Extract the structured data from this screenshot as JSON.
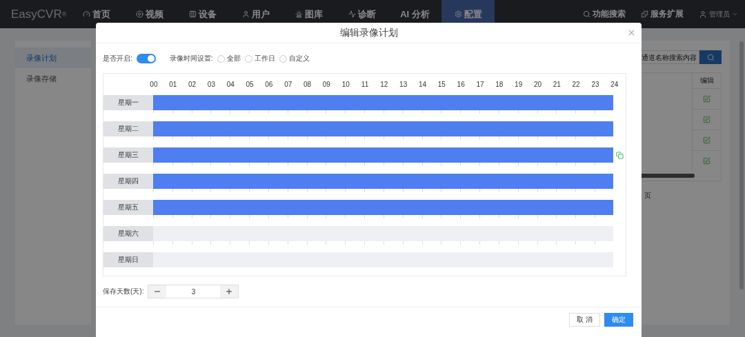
{
  "nav": {
    "logo": "EasyCVR",
    "logo_mark": "®",
    "items": [
      {
        "label": "首页",
        "selected": false
      },
      {
        "label": "视频",
        "selected": false
      },
      {
        "label": "设备",
        "selected": false
      },
      {
        "label": "用户",
        "selected": false
      },
      {
        "label": "图库",
        "selected": false
      },
      {
        "label": "诊断",
        "selected": false
      },
      {
        "label": "AI 分析",
        "selected": false
      },
      {
        "label": "配置",
        "selected": true
      }
    ],
    "actions": [
      {
        "label": "功能搜索"
      },
      {
        "label": "服务扩展"
      }
    ],
    "user": "管理员"
  },
  "sidebar": {
    "items": [
      {
        "label": "录像计划",
        "selected": true
      },
      {
        "label": "录像存储",
        "selected": false
      }
    ]
  },
  "search": {
    "placeholder": "通道名称搜索内容"
  },
  "table": {
    "columns": [
      "编辑"
    ],
    "rows": [
      {
        "kind": "edit"
      },
      {
        "kind": "edit"
      },
      {
        "kind": "edit"
      },
      {
        "kind": "edit"
      }
    ]
  },
  "pagination": {
    "text": "页"
  },
  "dialog": {
    "title": "编辑录像计划",
    "enabled": {
      "label": "是否开启:",
      "on": true
    },
    "time_setting": {
      "label": "录像时间设置:",
      "options": [
        {
          "label": "全部",
          "selected": false
        },
        {
          "label": "工作日",
          "selected": false
        },
        {
          "label": "自定义",
          "selected": false
        }
      ]
    },
    "hours": [
      "00",
      "01",
      "02",
      "03",
      "04",
      "05",
      "06",
      "07",
      "08",
      "09",
      "10",
      "11",
      "12",
      "13",
      "14",
      "15",
      "16",
      "17",
      "18",
      "19",
      "20",
      "21",
      "22",
      "23",
      "24"
    ],
    "days": [
      {
        "label": "星期一",
        "level": 1,
        "copy_icon": false
      },
      {
        "label": "星期二",
        "level": 1,
        "copy_icon": false
      },
      {
        "label": "星期三",
        "level": 1,
        "copy_icon": true
      },
      {
        "label": "星期四",
        "level": 1,
        "copy_icon": false
      },
      {
        "label": "星期五",
        "level": 1,
        "copy_icon": false
      },
      {
        "label": "星期六",
        "level": 0,
        "copy_icon": false
      },
      {
        "label": "星期日",
        "level": 0,
        "copy_icon": false
      }
    ],
    "retention": {
      "label": "保存天数(天):",
      "value": "3"
    },
    "buttons": [
      {
        "label": "取 消",
        "kind": "default"
      },
      {
        "label": "确定",
        "kind": "primary"
      }
    ]
  }
}
